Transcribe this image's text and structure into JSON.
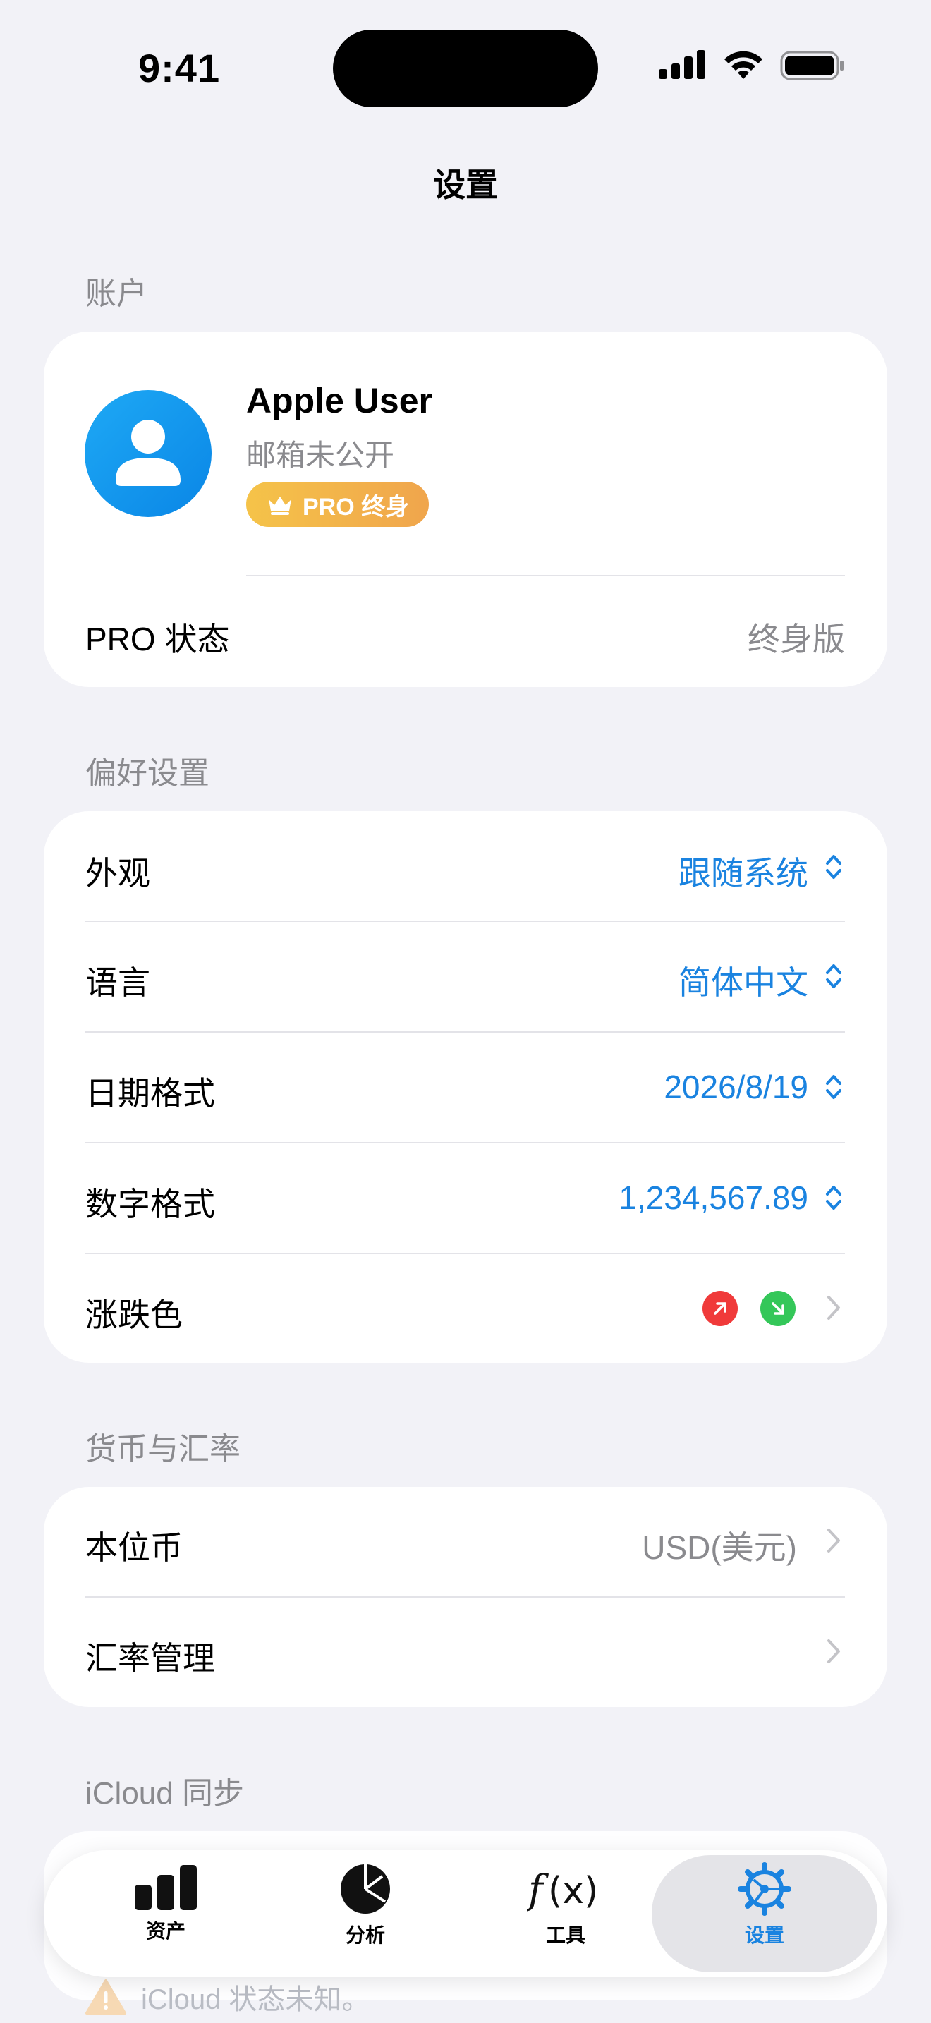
{
  "status_bar": {
    "time": "9:41"
  },
  "nav": {
    "title": "设置"
  },
  "account": {
    "header": "账户",
    "name": "Apple User",
    "email": "邮箱未公开",
    "badge": "PRO 终身",
    "pro_status_label": "PRO 状态",
    "pro_status_value": "终身版"
  },
  "preferences": {
    "header": "偏好设置",
    "rows": [
      {
        "label": "外观",
        "value": "跟随系统"
      },
      {
        "label": "语言",
        "value": "简体中文"
      },
      {
        "label": "日期格式",
        "value": "2026/8/19"
      },
      {
        "label": "数字格式",
        "value": "1,234,567.89"
      }
    ],
    "color_row_label": "涨跌色",
    "up_color": "#F03A3A",
    "down_color": "#34C759"
  },
  "currency": {
    "header": "货币与汇率",
    "base_label": "本位币",
    "base_value": "USD(美元)",
    "rates_label": "汇率管理"
  },
  "icloud": {
    "header": "iCloud 同步",
    "status_text": "iCloud 状态未知。"
  },
  "tabbar": {
    "items": [
      {
        "label": "资产",
        "icon": "bar-chart-icon"
      },
      {
        "label": "分析",
        "icon": "pie-chart-icon"
      },
      {
        "label": "工具",
        "icon": "function-icon"
      },
      {
        "label": "设置",
        "icon": "gear-icon"
      }
    ],
    "active_color": "#1A83E0"
  }
}
